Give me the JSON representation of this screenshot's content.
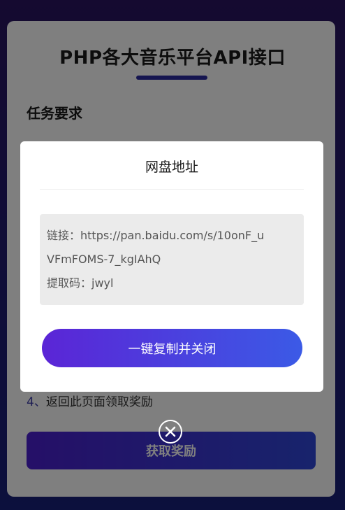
{
  "page": {
    "title": "PHP各大音乐平台API接口",
    "section_title": "任务要求",
    "step4_number": "4、",
    "step4_text": "返回此页面领取奖励",
    "reward_button": "获取奖励"
  },
  "modal": {
    "title": "网盘地址",
    "link_line1": "链接：https://pan.baidu.com/s/10onF_u",
    "link_line2": "VFmFOMS-7_kgIAhQ",
    "code_line": "提取码：jwyl",
    "copy_button": "一键复制并关闭",
    "close_icon": "close-circle-icon"
  },
  "colors": {
    "accent_start": "#5b25d6",
    "accent_end": "#3b5ae6",
    "background_top": "#2a1560",
    "background_bottom": "#18207a"
  }
}
